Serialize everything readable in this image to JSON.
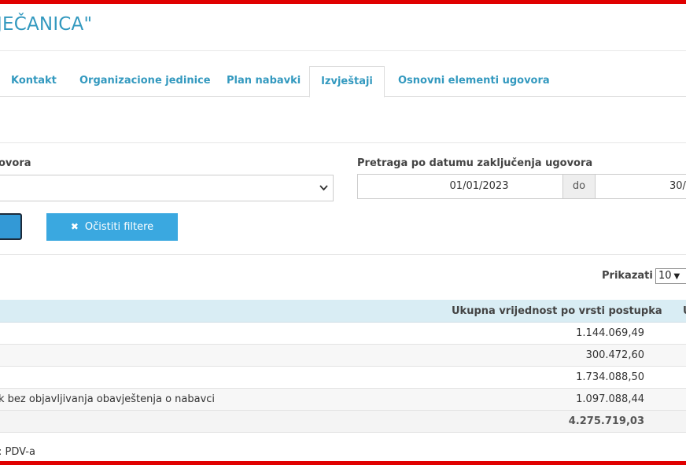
{
  "page": {
    "title": "JEČANICA\""
  },
  "tabs": [
    {
      "label": "Kontakt"
    },
    {
      "label": "Organizacione jedinice"
    },
    {
      "label": "Plan nabavki"
    },
    {
      "label": "Izvještaji",
      "active": true
    },
    {
      "label": "Osnovni elementi ugovora"
    }
  ],
  "filters": {
    "contract_type_label": "ovora",
    "contract_type_value": "",
    "date_label": "Pretraga po datumu zaključenja ugovora",
    "date_from": "01/01/2023",
    "date_separator": "do",
    "date_to": "30/",
    "clear_button": "Očistiti filtere",
    "clear_icon": "✖"
  },
  "table": {
    "show_label": "Prikazati",
    "show_value": "10",
    "columns": {
      "total_by_type": "Ukupna vrijednost po vrsti postupka",
      "next_col_fragment": "U"
    },
    "rows": [
      {
        "name": "",
        "value": "1.144.069,49"
      },
      {
        "name": "",
        "value": "300.472,60"
      },
      {
        "name": "",
        "value": "1.734.088,50"
      },
      {
        "name": "k bez objavljivanja obavještenja o nabavci",
        "value": "1.097.088,44"
      }
    ],
    "total": "4.275.719,03"
  },
  "footer": {
    "note": ": PDV-a"
  },
  "colors": {
    "accent": "#3399bf",
    "button": "#3aa8e0",
    "header_bg": "#d9edf4",
    "frame": "#e00000"
  }
}
